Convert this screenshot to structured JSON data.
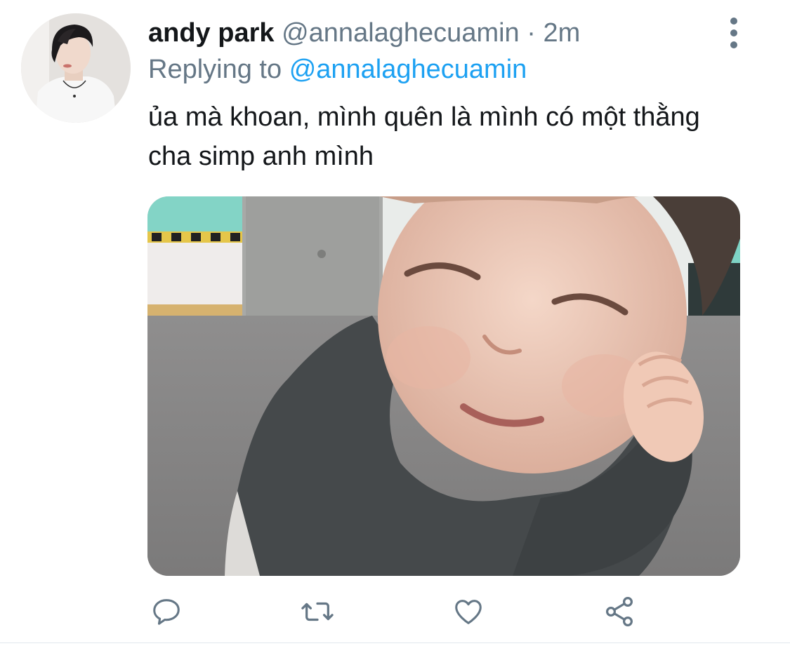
{
  "tweet": {
    "author_name": "andy park",
    "author_handle": "@annalaghecuamin",
    "separator": "·",
    "timestamp": "2m",
    "replying_prefix": "Replying to",
    "replying_to": "@annalaghecuamin",
    "text": "ủa mà khoan, mình quên là mình có một thằng cha simp anh mình"
  },
  "actions": {
    "reply_icon": "reply-icon",
    "retweet_icon": "retweet-icon",
    "like_icon": "heart-icon",
    "share_icon": "share-icon"
  },
  "colors": {
    "text": "#14171a",
    "secondary": "#657786",
    "link": "#1da1f2"
  }
}
